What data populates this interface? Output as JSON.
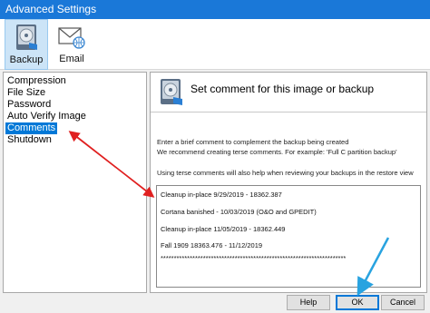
{
  "window": {
    "title": "Advanced Settings"
  },
  "toolbar": {
    "items": [
      {
        "label": "Backup",
        "icon": "backup-disk-icon",
        "selected": true
      },
      {
        "label": "Email",
        "icon": "email-envelope-icon",
        "selected": false
      }
    ]
  },
  "sidebar": {
    "items": [
      {
        "label": "Compression"
      },
      {
        "label": "File Size"
      },
      {
        "label": "Password"
      },
      {
        "label": "Auto Verify Image"
      },
      {
        "label": "Comments",
        "selected": true
      },
      {
        "label": "Shutdown"
      }
    ]
  },
  "main": {
    "header_title": "Set comment for this image or backup",
    "header_icon": "disk-icon",
    "description": [
      "Enter a brief comment to complement the backup being created",
      "We recommend creating terse comments. For example: 'Full C partition backup'",
      "Using terse comments will also help when reviewing your backups in the restore view"
    ],
    "comment_lines": [
      "Cleanup in-place 9/29/2019 - 18362.387",
      "Cortana  banished - 10/03/2019  (O&O and GPEDIT)",
      "Cleanup in-place 11/05/2019 - 18362.449",
      "Fall 1909 18363.476 - 11/12/2019",
      "**********************************************************************"
    ]
  },
  "buttons": {
    "help": "Help",
    "ok": "OK",
    "cancel": "Cancel"
  },
  "colors": {
    "titlebar": "#1a78d8",
    "selection": "#0078d7",
    "annotation_red": "#e02020",
    "annotation_blue": "#29a3e0"
  }
}
